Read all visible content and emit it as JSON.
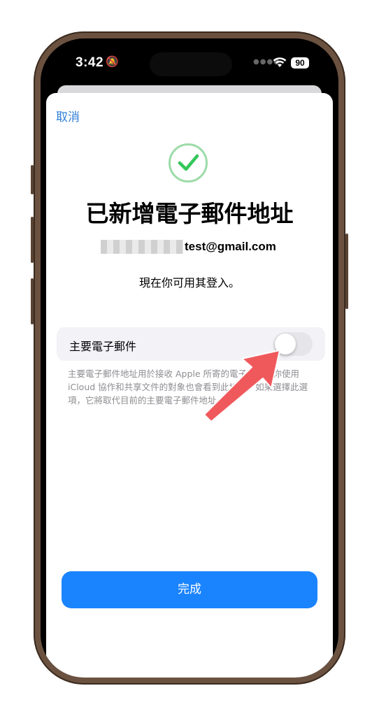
{
  "status_bar": {
    "time": "3:42",
    "battery": "90"
  },
  "sheet": {
    "cancel_label": "取消",
    "title": "已新增電子郵件地址",
    "email_suffix": "test@gmail.com",
    "sign_in_text": "現在你可用其登入。",
    "primary_email_label": "主要電子郵件",
    "primary_email_toggle_on": false,
    "footnote": "主要電子郵件地址用於接收 Apple 所寄的電子郵件。你使用 iCloud 協作和共享文件的對象也會看到此地址。如果選擇此選項，它將取代目前的主要電子郵件地址。",
    "done_label": "完成"
  },
  "colors": {
    "accent": "#1a84ff",
    "link": "#2f7fd8",
    "success": "#34c759",
    "annotation_arrow": "#f0595c"
  }
}
